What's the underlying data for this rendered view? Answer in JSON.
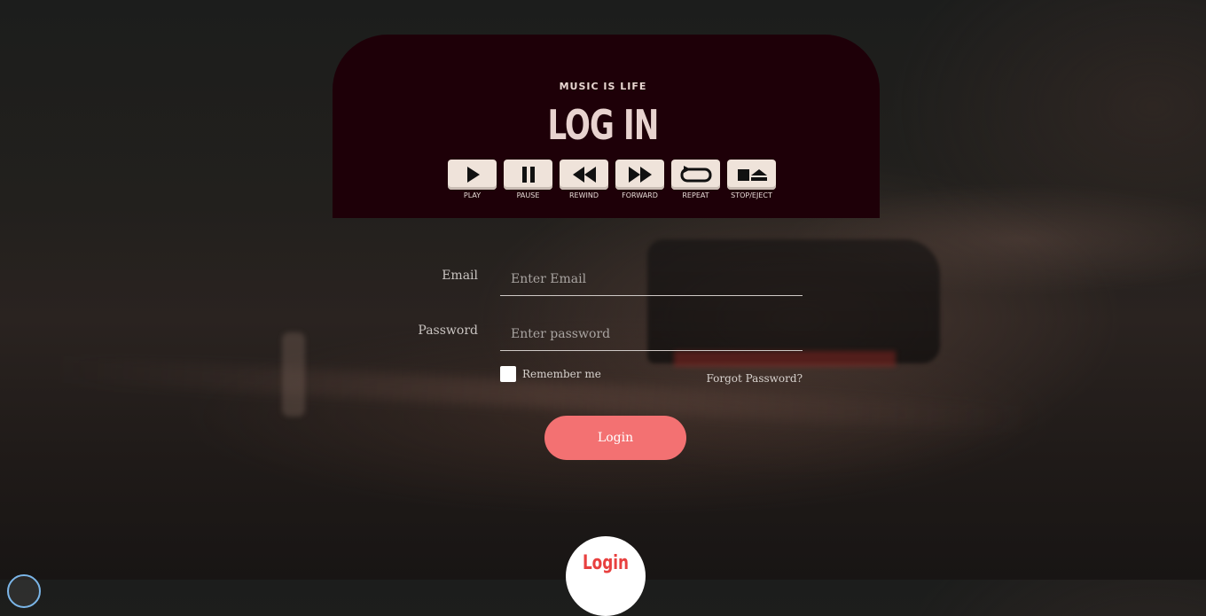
{
  "header": {
    "tagline": "MUSIC IS LIFE",
    "title": "LOG IN",
    "controls": [
      {
        "icon": "play-icon",
        "label": "PLAY"
      },
      {
        "icon": "pause-icon",
        "label": "PAUSE"
      },
      {
        "icon": "rewind-icon",
        "label": "REWIND"
      },
      {
        "icon": "forward-icon",
        "label": "FORWARD"
      },
      {
        "icon": "repeat-icon",
        "label": "REPEAT"
      },
      {
        "icon": "stop-eject-icon",
        "label": "STOP/EJECT"
      }
    ]
  },
  "form": {
    "email_label": "Email",
    "email_placeholder": "Enter Email",
    "email_value": "",
    "password_label": "Password",
    "password_placeholder": "Enter password",
    "password_value": "",
    "remember_label": "Remember me",
    "remember_checked": false,
    "forgot_label": "Forgot Password?",
    "login_label": "Login"
  },
  "bubble": {
    "label": "Login"
  },
  "colors": {
    "header_bg": "#1e0008",
    "accent": "#f37172",
    "bubble_text": "#e8403f"
  }
}
